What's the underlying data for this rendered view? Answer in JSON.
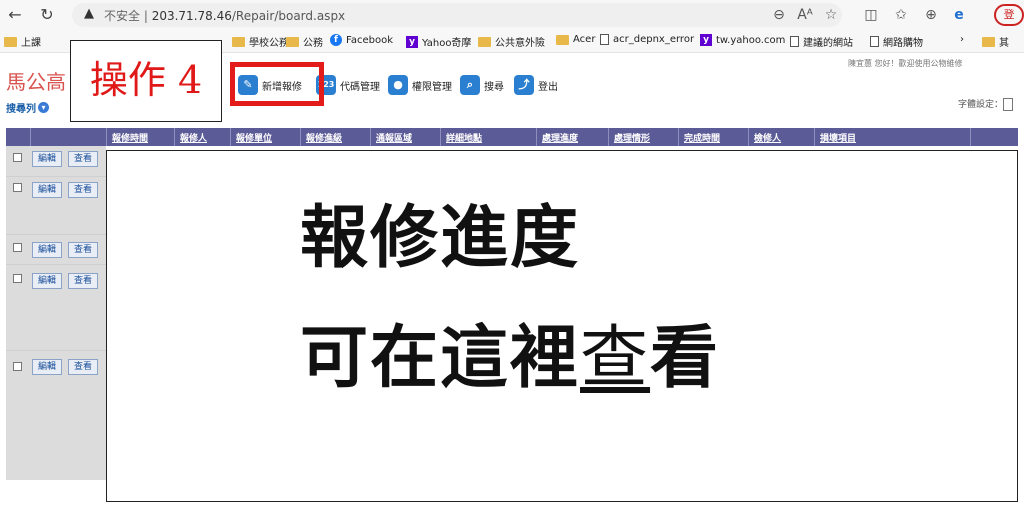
{
  "browser": {
    "security_warning": "不安全",
    "url_host": "203.71.78.46",
    "url_path": "/Repair/board.aspx",
    "profile_label": "登"
  },
  "bookmarks": [
    {
      "label": "上課",
      "icon": "folder-icon"
    },
    {
      "label": "學校公務",
      "icon": "folder-icon"
    },
    {
      "label": "公務",
      "icon": "folder-icon"
    },
    {
      "label": "Facebook",
      "icon": "facebook-icon"
    },
    {
      "label": "Yahoo奇摩",
      "icon": "yahoo-icon"
    },
    {
      "label": "公共意外險",
      "icon": "folder-icon"
    },
    {
      "label": "Acer",
      "icon": "folder-icon"
    },
    {
      "label": "acr_depnx_error",
      "icon": "page-icon"
    },
    {
      "label": "tw.yahoo.com",
      "icon": "yahoo-icon"
    },
    {
      "label": "建議的網站",
      "icon": "page-icon"
    },
    {
      "label": "網路購物",
      "icon": "page-icon"
    },
    {
      "label": "其",
      "icon": "folder-icon"
    }
  ],
  "page": {
    "site_title": "馬公高",
    "search_list": "搜尋列",
    "greeting": "陳宜蕙 您好！歡迎使用公物維修",
    "font_setting": "字體設定："
  },
  "annotation": {
    "step_label": "操作 4"
  },
  "menu": [
    {
      "label": "新增報修",
      "icon": "wrench-icon",
      "color": "#2b7fd0"
    },
    {
      "label": "代碼管理",
      "icon": "code-123-icon",
      "color": "#2b7fd0"
    },
    {
      "label": "權限管理",
      "icon": "user-icon",
      "color": "#2b7fd0"
    },
    {
      "label": "搜尋",
      "icon": "search-icon",
      "color": "#2b7fd0"
    },
    {
      "label": "登出",
      "icon": "logout-icon",
      "color": "#2b7fd0"
    }
  ],
  "table": {
    "columns": [
      "報修時間",
      "報修人",
      "報修單位",
      "報修進級",
      "通報區域",
      "詳細地點",
      "處理進度",
      "處理情形",
      "完成時間",
      "檢修人",
      "損壞項目"
    ],
    "row_buttons": {
      "edit": "編輯",
      "view": "查看"
    },
    "row_count": 5
  },
  "overlay": {
    "line1": "報修進度",
    "line2_main": "可在這裡",
    "line2_light": "查",
    "line2_end": "看"
  },
  "colors": {
    "table_header": "#5b5b97",
    "highlight_red": "#e41b1b",
    "site_title": "#d9534f"
  }
}
